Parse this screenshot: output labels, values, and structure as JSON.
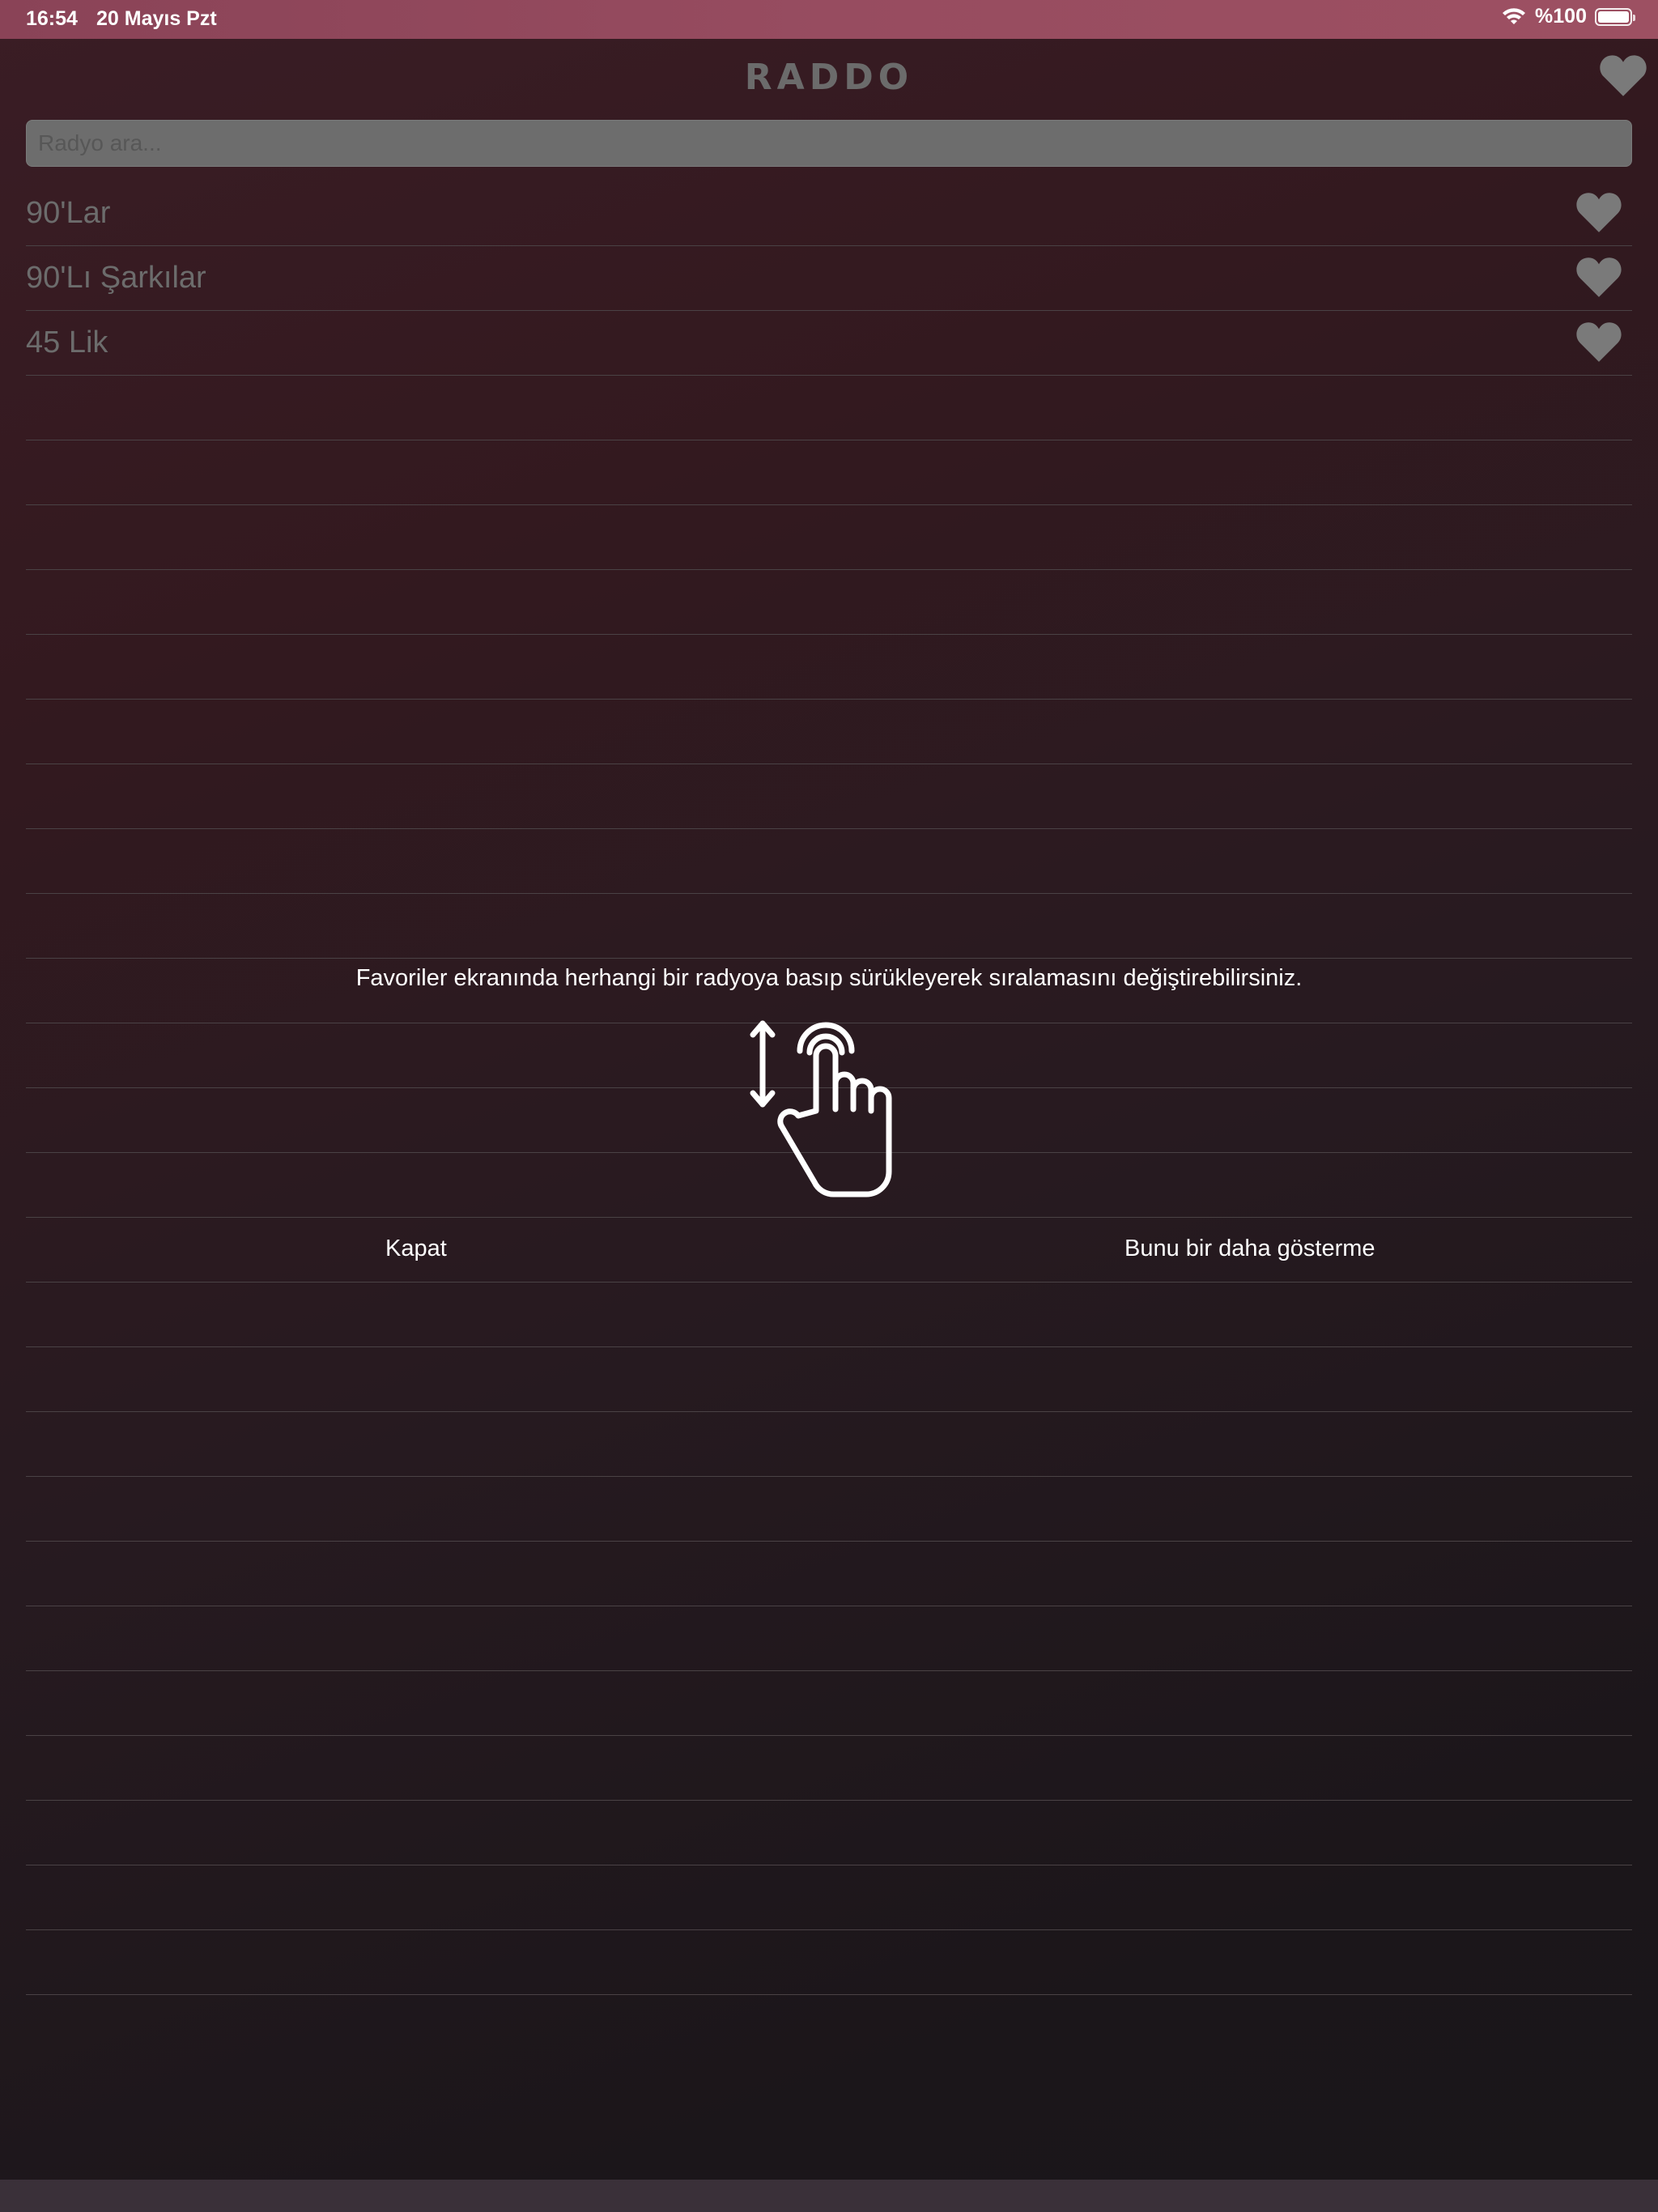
{
  "status_bar": {
    "time": "16:54",
    "date": "20 Mayıs Pzt",
    "battery": "%100"
  },
  "header": {
    "logo": "RADDO"
  },
  "search": {
    "placeholder": "Radyo ara..."
  },
  "stations": [
    {
      "label": "90'Lar"
    },
    {
      "label": "90'Lı Şarkılar"
    },
    {
      "label": "45 Lik"
    }
  ],
  "overlay": {
    "message": "Favoriler ekranında herhangi bir radyoya basıp sürükleyerek sıralamasını değiştirebilirsiniz.",
    "close_label": "Kapat",
    "dont_show_label": "Bunu bir daha gösterme"
  },
  "colors": {
    "status_bar": "#974c60",
    "heart": "#7a7a7a",
    "text_muted": "#6c6c6c",
    "overlay_text": "#ffffff"
  }
}
